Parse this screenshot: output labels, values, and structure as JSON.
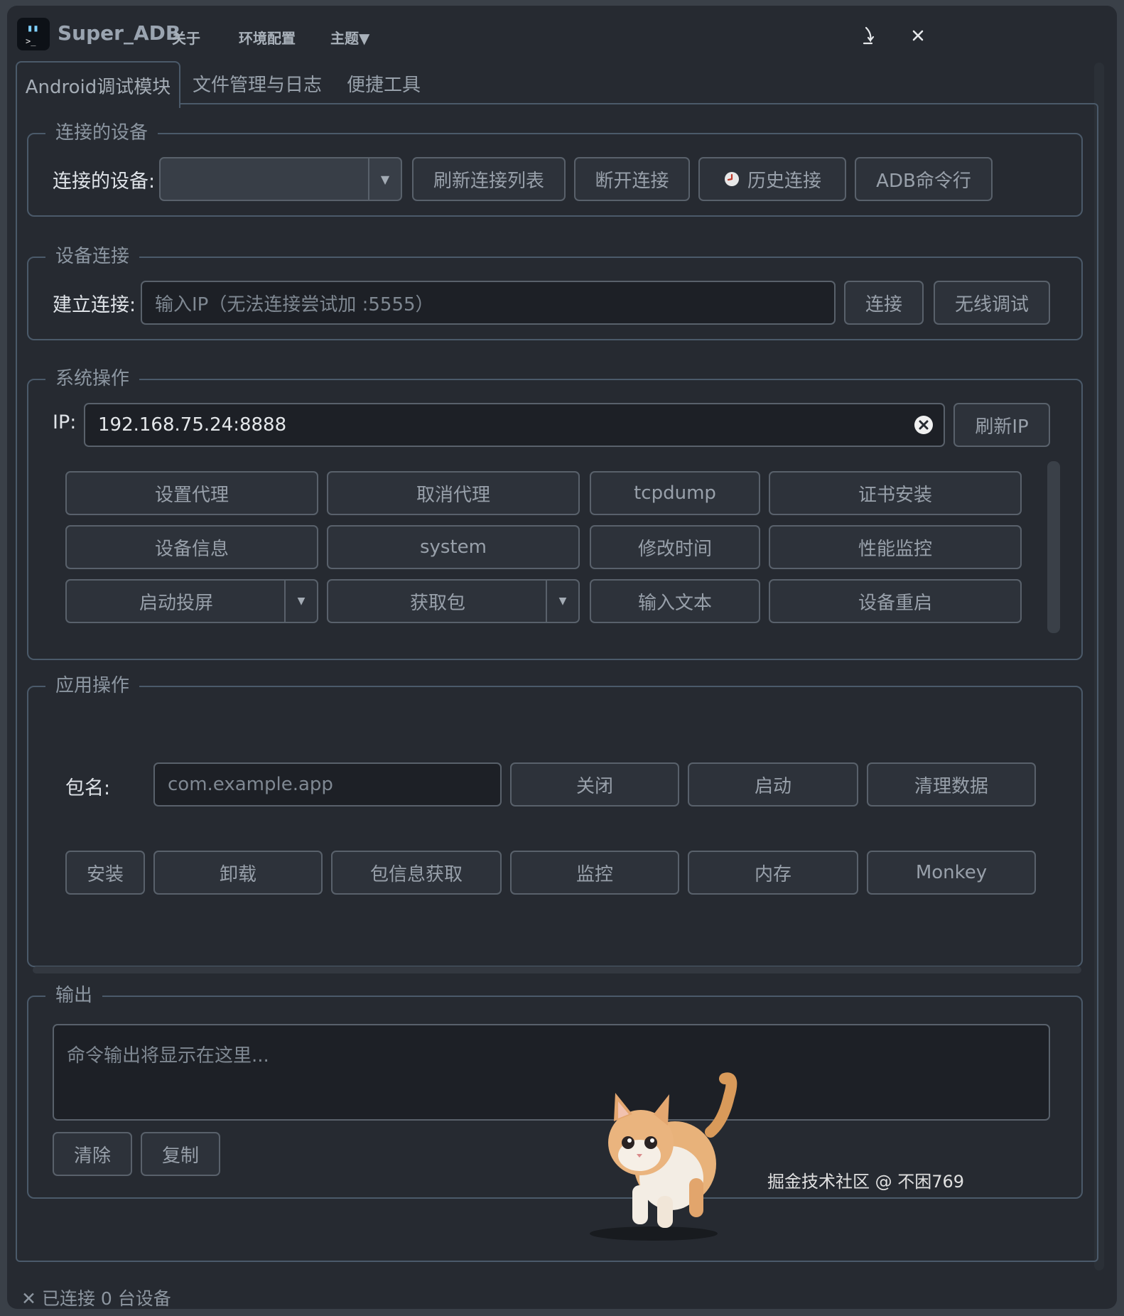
{
  "window": {
    "title": "Super_ADB",
    "menu": [
      "关于",
      "环境配置",
      "主题▼"
    ],
    "minimize_glyph": "⤸",
    "close_glyph": "✕"
  },
  "tabs": [
    {
      "label": "Android调试模块",
      "active": true
    },
    {
      "label": "文件管理与日志",
      "active": false
    },
    {
      "label": "便捷工具",
      "active": false
    }
  ],
  "connected_devices": {
    "legend": "连接的设备",
    "label": "连接的设备:",
    "selected": "",
    "buttons": {
      "refresh": "刷新连接列表",
      "disconnect": "断开连接",
      "history": "历史连接",
      "adb_cmd": "ADB命令行"
    }
  },
  "device_connect": {
    "legend": "设备连接",
    "label": "建立连接:",
    "placeholder": "输入IP（无法连接尝试加 :5555）",
    "buttons": {
      "connect": "连接",
      "wireless": "无线调试"
    }
  },
  "system_ops": {
    "legend": "系统操作",
    "ip_label": "IP:",
    "ip_value": "192.168.75.24:8888",
    "refresh_ip": "刷新IP",
    "row1": [
      "设置代理",
      "取消代理",
      "tcpdump",
      "证书安装"
    ],
    "row2": [
      "设备信息",
      "system",
      "修改时间",
      "性能监控"
    ],
    "row3": [
      "启动投屏",
      "获取包",
      "输入文本",
      "设备重启"
    ]
  },
  "app_ops": {
    "legend": "应用操作",
    "pkg_label": "包名:",
    "pkg_placeholder": "com.example.app",
    "row1": [
      "关闭",
      "启动",
      "清理数据"
    ],
    "row2": [
      "安装",
      "卸载",
      "包信息获取",
      "监控",
      "内存",
      "Monkey"
    ]
  },
  "output": {
    "legend": "输出",
    "placeholder": "命令输出将显示在这里...",
    "buttons": {
      "clear": "清除",
      "copy": "复制"
    }
  },
  "status_bar": {
    "icon": "✕",
    "text": "已连接 0 台设备"
  },
  "watermark": "掘金技术社区 @ 不困769"
}
